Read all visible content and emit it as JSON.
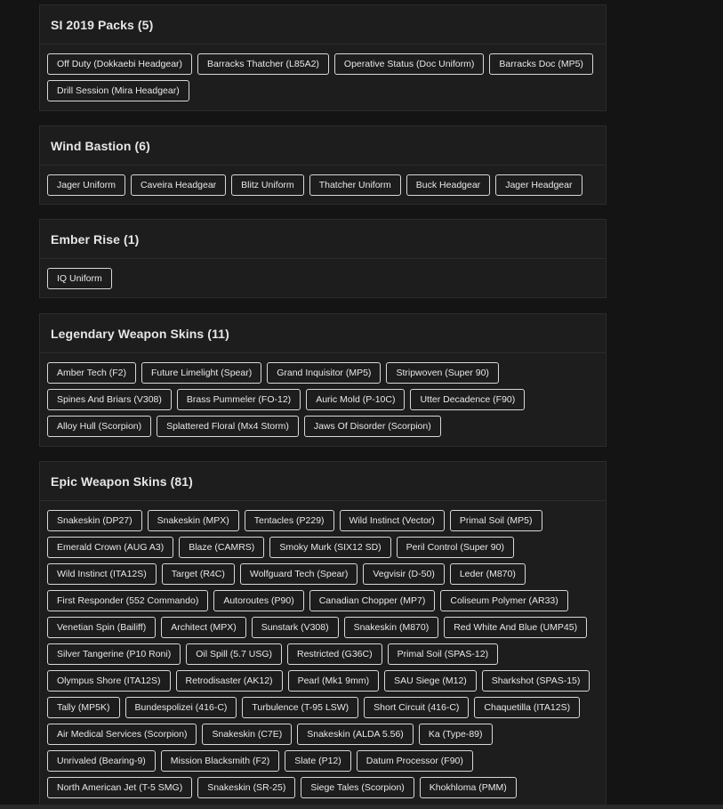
{
  "sections": [
    {
      "title": "SI 2019 Packs (5)",
      "items": [
        "Off Duty (Dokkaebi Headgear)",
        "Barracks Thatcher (L85A2)",
        "Operative Status (Doc Uniform)",
        "Barracks Doc (MP5)",
        "Drill Session (Mira Headgear)"
      ]
    },
    {
      "title": "Wind Bastion (6)",
      "items": [
        "Jager Uniform",
        "Caveira Headgear",
        "Blitz Uniform",
        "Thatcher Uniform",
        "Buck Headgear",
        "Jager Headgear"
      ]
    },
    {
      "title": "Ember Rise (1)",
      "items": [
        "IQ Uniform"
      ]
    },
    {
      "title": "Legendary Weapon Skins (11)",
      "items": [
        "Amber Tech (F2)",
        "Future Limelight (Spear)",
        "Grand Inquisitor (MP5)",
        "Stripwoven (Super 90)",
        "Spines And Briars (V308)",
        "Brass Pummeler (FO-12)",
        "Auric Mold (P-10C)",
        "Utter Decadence (F90)",
        "Alloy Hull (Scorpion)",
        "Splattered Floral (Mx4 Storm)",
        "Jaws Of Disorder (Scorpion)"
      ]
    },
    {
      "title": "Epic Weapon Skins (81)",
      "items": [
        "Snakeskin (DP27)",
        "Snakeskin (MPX)",
        "Tentacles (P229)",
        "Wild Instinct (Vector)",
        "Primal Soil (MP5)",
        "Emerald Crown (AUG A3)",
        "Blaze (CAMRS)",
        "Smoky Murk (SIX12 SD)",
        "Peril Control (Super 90)",
        "Wild Instinct (ITA12S)",
        "Target (R4C)",
        "Wolfguard Tech (Spear)",
        "Vegvisir (D-50)",
        "Leder (M870)",
        "First Responder (552 Commando)",
        "Autoroutes (P90)",
        "Canadian Chopper (MP7)",
        "Coliseum Polymer (AR33)",
        "Venetian Spin (Bailiff)",
        "Architect (MPX)",
        "Sunstark (V308)",
        "Snakeskin (M870)",
        "Red White And Blue (UMP45)",
        "Silver Tangerine (P10 Roni)",
        "Oil Spill (5.7 USG)",
        "Restricted (G36C)",
        "Primal Soil (SPAS-12)",
        "Olympus Shore (ITA12S)",
        "Retrodisaster (AK12)",
        "Pearl (Mk1 9mm)",
        "SAU Siege (M12)",
        "Sharkshot (SPAS-15)",
        "Tally (MP5K)",
        "Bundespolizei (416-C)",
        "Turbulence (T-95 LSW)",
        "Short Circuit (416-C)",
        "Chaquetilla (ITA12S)",
        "Air Medical Services (Scorpion)",
        "Snakeskin (C7E)",
        "Snakeskin (ALDA 5.56)",
        "Ka (Type-89)",
        "Unrivaled (Bearing-9)",
        "Mission Blacksmith (F2)",
        "Slate (P12)",
        "Datum Processor (F90)",
        "North American Jet (T-5 SMG)",
        "Snakeskin (SR-25)",
        "Siege Tales (Scorpion)",
        "Khokhloma (PMM)"
      ]
    }
  ]
}
